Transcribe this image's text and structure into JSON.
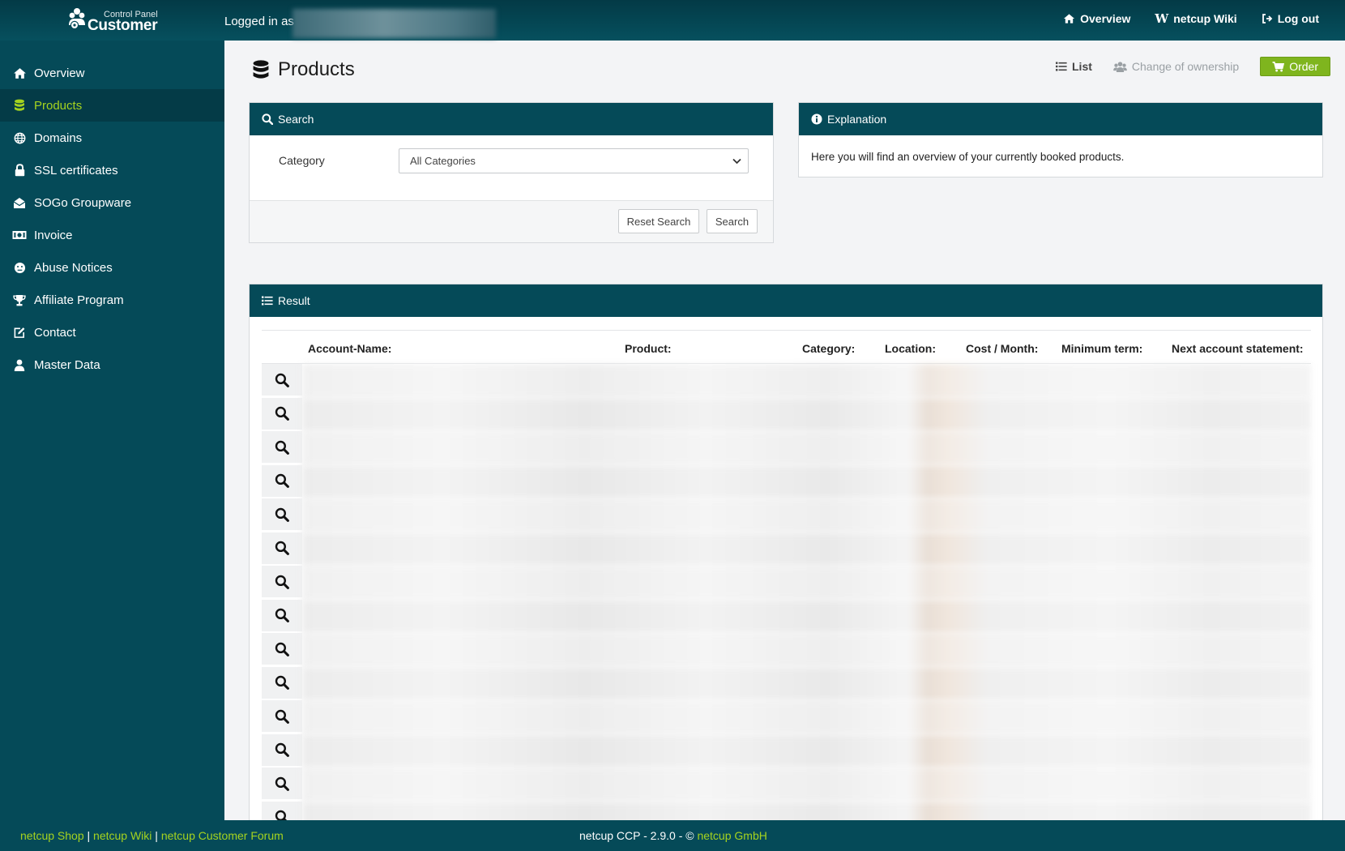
{
  "header": {
    "logo_sub": "Control Panel",
    "logo_main": "Customer",
    "logged_in_label": "Logged in as",
    "nav": [
      {
        "label": "Overview",
        "icon": "home-icon"
      },
      {
        "label": "netcup Wiki",
        "icon": "wiki-w-icon"
      },
      {
        "label": "Log out",
        "icon": "logout-icon"
      }
    ]
  },
  "sidebar": {
    "items": [
      {
        "label": "Overview",
        "icon": "home-icon",
        "active": false
      },
      {
        "label": "Products",
        "icon": "database-icon",
        "active": true
      },
      {
        "label": "Domains",
        "icon": "globe-icon",
        "active": false
      },
      {
        "label": "SSL certificates",
        "icon": "lock-icon",
        "active": false
      },
      {
        "label": "SOGo Groupware",
        "icon": "envelope-open-icon",
        "active": false
      },
      {
        "label": "Invoice",
        "icon": "money-icon",
        "active": false
      },
      {
        "label": "Abuse Notices",
        "icon": "face-icon",
        "active": false
      },
      {
        "label": "Affiliate Program",
        "icon": "trophy-icon",
        "active": false
      },
      {
        "label": "Contact",
        "icon": "edit-icon",
        "active": false
      },
      {
        "label": "Master Data",
        "icon": "user-icon",
        "active": false
      }
    ]
  },
  "page": {
    "title": "Products",
    "actions": {
      "list": "List",
      "change_owner": "Change of ownership",
      "order": "Order"
    }
  },
  "search": {
    "title": "Search",
    "category_label": "Category",
    "category_value": "All Categories",
    "reset_label": "Reset Search",
    "search_label": "Search"
  },
  "explanation": {
    "title": "Explanation",
    "text": "Here you will find an overview of your currently booked products."
  },
  "result": {
    "title": "Result",
    "columns": [
      "Account-Name:",
      "Product:",
      "Category:",
      "Location:",
      "Cost / Month:",
      "Minimum term:",
      "Next account statement:"
    ],
    "row_count": 14
  },
  "footer": {
    "links": [
      "netcup Shop",
      "netcup Wiki",
      "netcup Customer Forum"
    ],
    "separator": " | ",
    "copyright_prefix": "netcup CCP - 2.9.0 - © ",
    "company": "netcup GmbH"
  },
  "colors": {
    "brand_teal": "#054a58",
    "accent_green": "#a5d31f",
    "order_green": "#7fb51e"
  }
}
